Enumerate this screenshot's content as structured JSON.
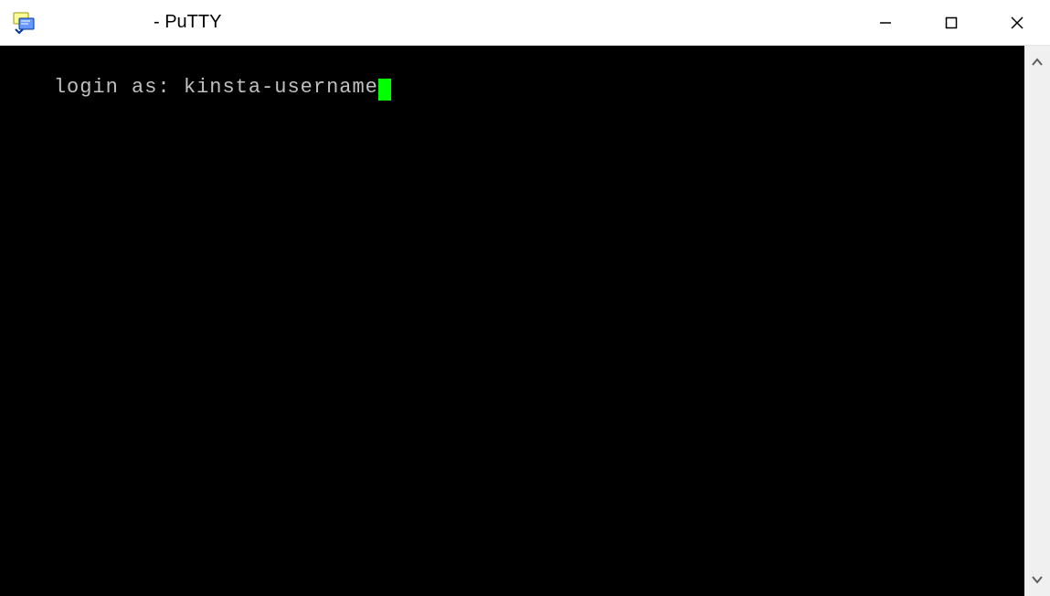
{
  "window": {
    "title": "- PuTTY",
    "controls": {
      "minimize": "Minimize",
      "maximize": "Maximize",
      "close": "Close"
    }
  },
  "terminal": {
    "prompt": "login as:",
    "input": "kinsta-username"
  },
  "scrollbar": {
    "up": "▲",
    "down": "▼"
  }
}
